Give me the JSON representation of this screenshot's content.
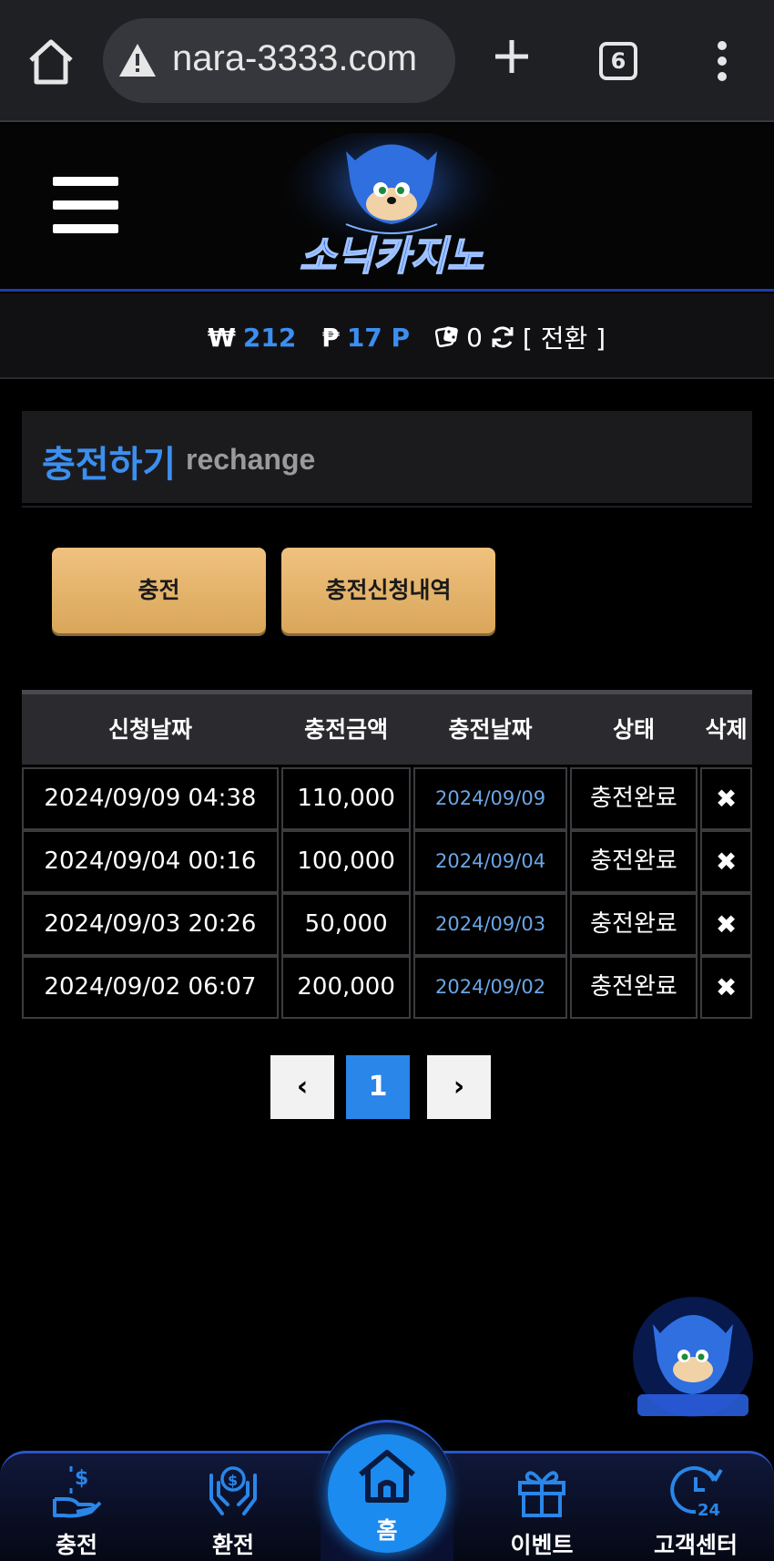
{
  "browser": {
    "url": "nara-3333.com",
    "tab_count": "6"
  },
  "header": {
    "logo_text": "소닉카지노"
  },
  "balance": {
    "won_symbol": "₩",
    "won_value": "212",
    "point_symbol": "₱",
    "point_value": "17 P",
    "dice_value": "0",
    "switch_label": "[ 전환 ]"
  },
  "section": {
    "title_ko": "충전하기",
    "title_en": "rechange"
  },
  "buttons": {
    "charge": "충전",
    "history": "충전신청내역"
  },
  "table": {
    "headers": [
      "신청날짜",
      "충전금액",
      "충전날짜",
      "상태",
      "삭제"
    ],
    "rows": [
      {
        "request_date": "2024/09/09 04:38",
        "amount": "110,000",
        "charge_date": "2024/09/09",
        "status": "충전완료",
        "delete": "✖"
      },
      {
        "request_date": "2024/09/04 00:16",
        "amount": "100,000",
        "charge_date": "2024/09/04",
        "status": "충전완료",
        "delete": "✖"
      },
      {
        "request_date": "2024/09/03 20:26",
        "amount": "50,000",
        "charge_date": "2024/09/03",
        "status": "충전완료",
        "delete": "✖"
      },
      {
        "request_date": "2024/09/02 06:07",
        "amount": "200,000",
        "charge_date": "2024/09/02",
        "status": "충전완료",
        "delete": "✖"
      }
    ]
  },
  "pagination": {
    "prev": "‹",
    "current": "1",
    "next": "›"
  },
  "bottom_nav": {
    "charge": "충전",
    "exchange": "환전",
    "home": "홈",
    "event": "이벤트",
    "support": "고객센터"
  },
  "colors": {
    "accent_blue": "#3b8ff0",
    "gold_button": "#e8b86b",
    "link_blue": "#6aa6e6"
  }
}
